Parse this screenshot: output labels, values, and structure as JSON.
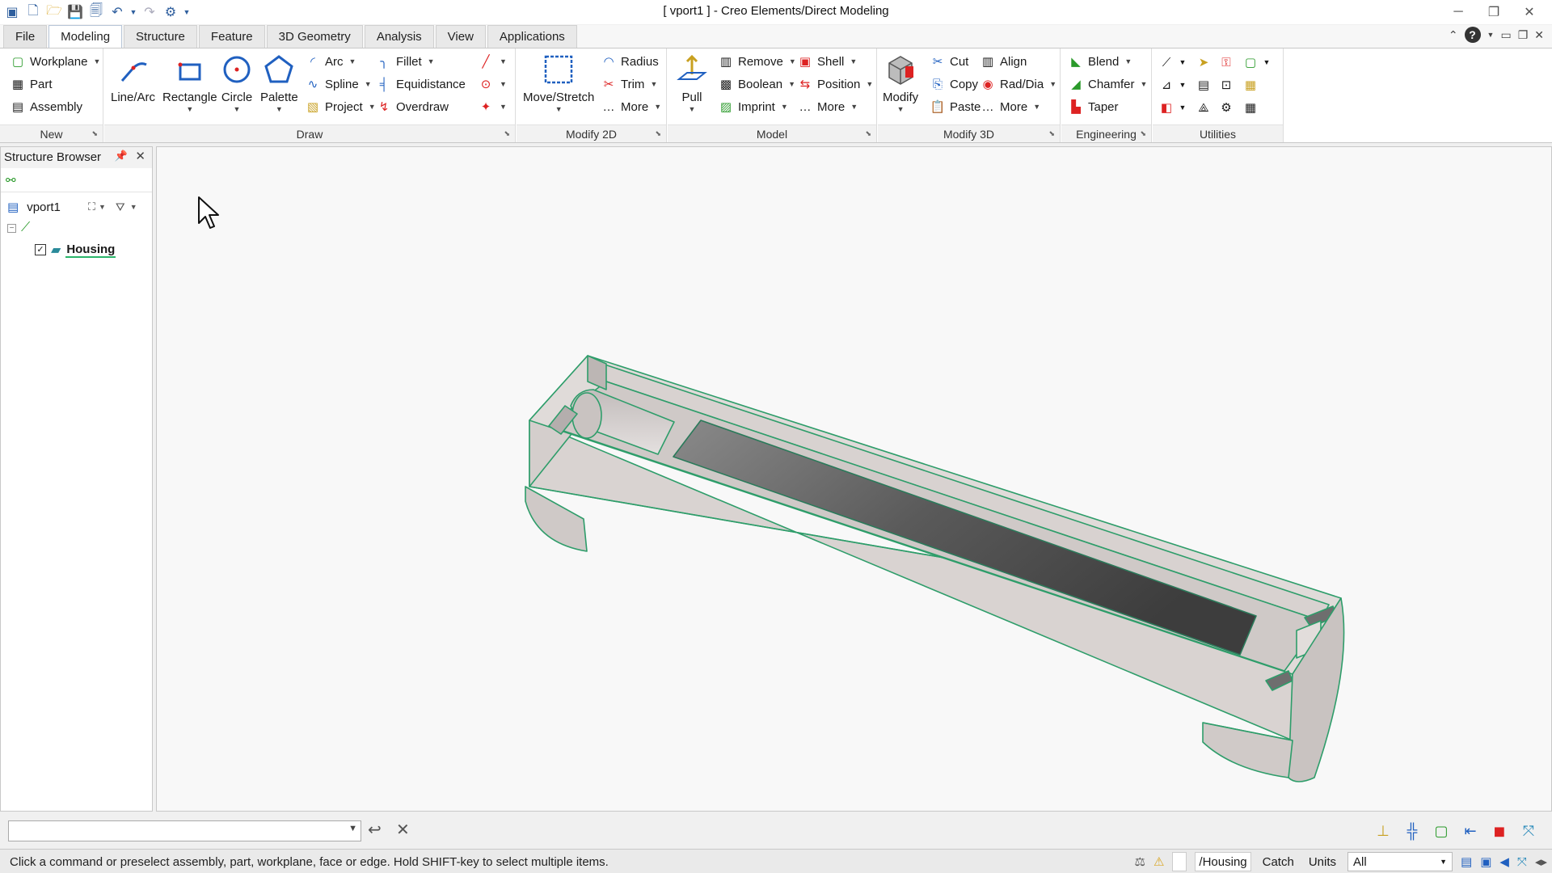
{
  "window": {
    "title": "[ vport1 ] - Creo Elements/Direct Modeling"
  },
  "tabs": [
    {
      "label": "File"
    },
    {
      "label": "Modeling",
      "active": true
    },
    {
      "label": "Structure"
    },
    {
      "label": "Feature"
    },
    {
      "label": "3D Geometry"
    },
    {
      "label": "Analysis"
    },
    {
      "label": "View"
    },
    {
      "label": "Applications"
    }
  ],
  "ribbon": {
    "new": {
      "label": "New",
      "workplane": "Workplane",
      "part": "Part",
      "assembly": "Assembly"
    },
    "draw": {
      "label": "Draw",
      "line_arc": "Line/Arc",
      "rectangle": "Rectangle",
      "circle": "Circle",
      "palette": "Palette",
      "arc": "Arc",
      "spline": "Spline",
      "project": "Project",
      "fillet": "Fillet",
      "equidistance": "Equidistance",
      "overdraw": "Overdraw"
    },
    "modify2d": {
      "label": "Modify 2D",
      "move_stretch": "Move/Stretch",
      "radius": "Radius",
      "trim": "Trim",
      "more": "More"
    },
    "model": {
      "label": "Model",
      "pull": "Pull",
      "remove": "Remove",
      "boolean": "Boolean",
      "imprint": "Imprint",
      "shell": "Shell",
      "position": "Position",
      "more": "More"
    },
    "modify3d": {
      "label": "Modify 3D",
      "modify": "Modify",
      "cut": "Cut",
      "copy": "Copy",
      "paste": "Paste",
      "align": "Align",
      "rad_dia": "Rad/Dia",
      "more": "More"
    },
    "engineering": {
      "label": "Engineering",
      "blend": "Blend",
      "chamfer": "Chamfer",
      "taper": "Taper"
    },
    "utilities": {
      "label": "Utilities"
    }
  },
  "browser": {
    "title": "Structure Browser",
    "viewport": "vport1",
    "part": "Housing"
  },
  "colors": {
    "edge": "#2e9d6a",
    "part_face": "#d8d2d0",
    "accent": "#2ab56a"
  },
  "status": {
    "message": "Click a command or preselect assembly, part, workplane, face or edge. Hold SHIFT-key to select multiple items.",
    "current_part": "/Housing",
    "catch": "Catch",
    "units": "Units",
    "filter": "All"
  }
}
